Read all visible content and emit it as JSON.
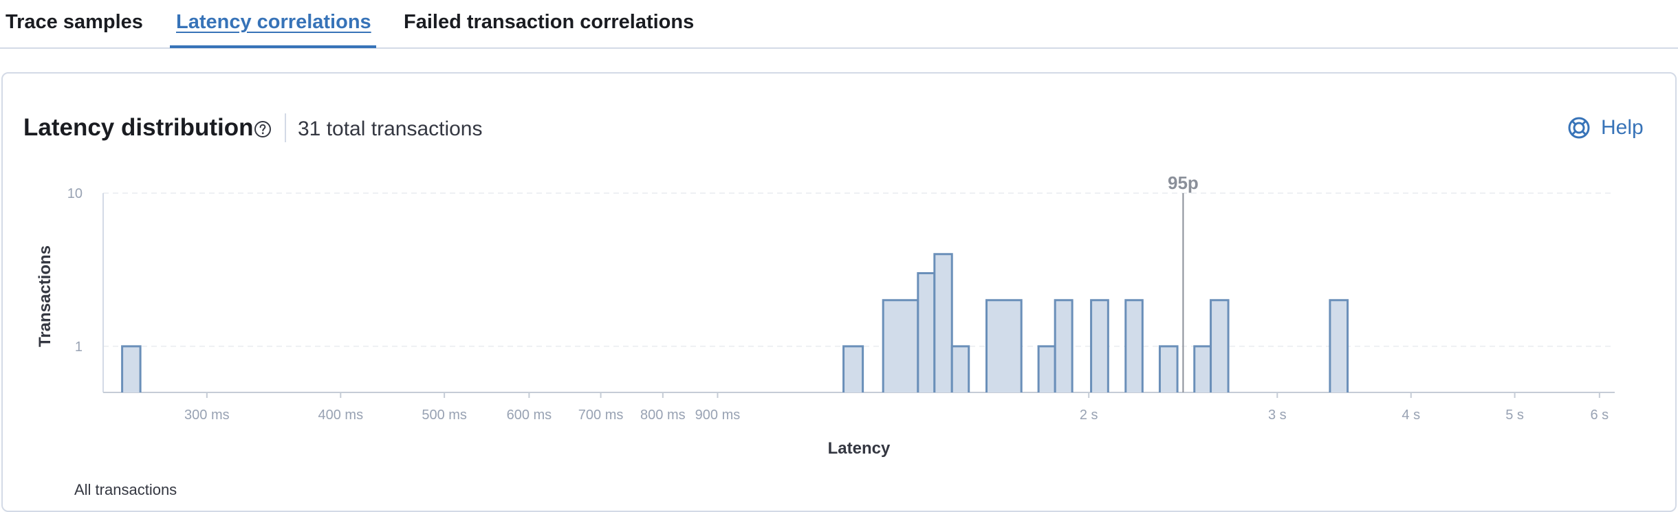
{
  "tabs": [
    {
      "label": "Trace samples",
      "active": false
    },
    {
      "label": "Latency correlations",
      "active": true
    },
    {
      "label": "Failed transaction correlations",
      "active": false
    }
  ],
  "panel": {
    "title": "Latency distribution",
    "total": "31 total transactions",
    "help_label": "Help"
  },
  "colors": {
    "accent": "#3773b8",
    "bar_fill": "#d1dcea",
    "bar_stroke": "#6a8fb9",
    "axis_text": "#98a2b3"
  },
  "icons": {
    "question": "question-circle-icon",
    "help": "lifebuoy-icon"
  },
  "chart_data": {
    "type": "bar",
    "xlabel": "Latency",
    "ylabel": "Transactions",
    "yscale": "log",
    "ylim": [
      0.5,
      10
    ],
    "y_ticks": [
      1,
      10
    ],
    "xscale": "log",
    "xlim_ms": [
      240,
      6200
    ],
    "x_ticks_ms": [
      300,
      400,
      500,
      600,
      700,
      800,
      900,
      2000,
      3000,
      4000,
      5000,
      6000
    ],
    "x_tick_labels": [
      "300 ms",
      "400 ms",
      "500 ms",
      "600 ms",
      "700 ms",
      "800 ms",
      "900 ms",
      "2 s",
      "3 s",
      "4 s",
      "5 s",
      "6 s"
    ],
    "percentile": {
      "label": "95p",
      "value_ms": 2450
    },
    "bins": [
      {
        "start_ms": 250,
        "end_ms": 260,
        "count": 1
      },
      {
        "start_ms": 1180,
        "end_ms": 1230,
        "count": 1
      },
      {
        "start_ms": 1285,
        "end_ms": 1385,
        "count": 2
      },
      {
        "start_ms": 1385,
        "end_ms": 1435,
        "count": 3
      },
      {
        "start_ms": 1435,
        "end_ms": 1490,
        "count": 4
      },
      {
        "start_ms": 1490,
        "end_ms": 1545,
        "count": 1
      },
      {
        "start_ms": 1605,
        "end_ms": 1730,
        "count": 2
      },
      {
        "start_ms": 1795,
        "end_ms": 1860,
        "count": 1
      },
      {
        "start_ms": 1860,
        "end_ms": 1930,
        "count": 2
      },
      {
        "start_ms": 2010,
        "end_ms": 2085,
        "count": 2
      },
      {
        "start_ms": 2165,
        "end_ms": 2245,
        "count": 2
      },
      {
        "start_ms": 2330,
        "end_ms": 2420,
        "count": 1
      },
      {
        "start_ms": 2510,
        "end_ms": 2600,
        "count": 1
      },
      {
        "start_ms": 2600,
        "end_ms": 2700,
        "count": 2
      },
      {
        "start_ms": 3360,
        "end_ms": 3490,
        "count": 2
      }
    ]
  },
  "legend": {
    "label": "All transactions"
  }
}
